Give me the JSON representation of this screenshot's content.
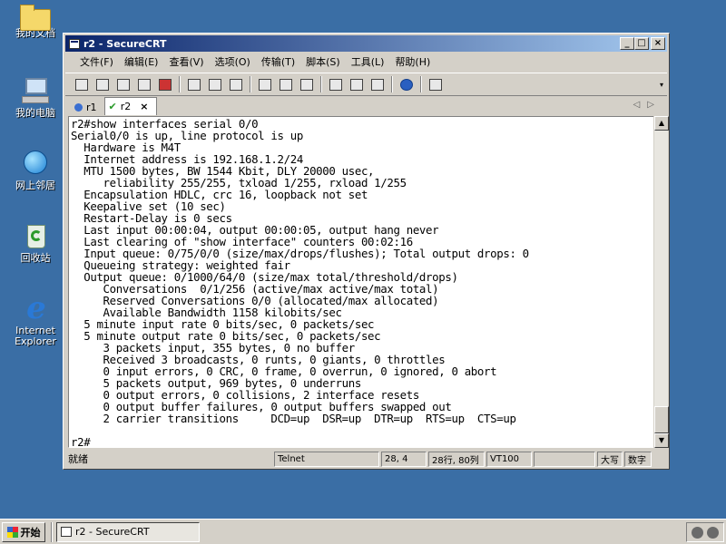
{
  "desktop": {
    "icons": [
      {
        "label": "我的文档",
        "icon": "folder-icon"
      },
      {
        "label": "我的电脑",
        "icon": "computer-icon"
      },
      {
        "label": "网上邻居",
        "icon": "network-icon"
      },
      {
        "label": "回收站",
        "icon": "recycle-bin-icon"
      },
      {
        "label": "Internet Explorer",
        "icon": "ie-icon"
      }
    ]
  },
  "window": {
    "title": "r2 - SecureCRT",
    "controls": {
      "minimize": "_",
      "maximize": "□",
      "close": "×"
    }
  },
  "menu": [
    "文件(F)",
    "编辑(E)",
    "查看(V)",
    "选项(O)",
    "传输(T)",
    "脚本(S)",
    "工具(L)",
    "帮助(H)"
  ],
  "tabs": [
    {
      "label": "r1",
      "active": false
    },
    {
      "label": "r2",
      "active": true,
      "close": "×"
    }
  ],
  "terminal": {
    "lines": [
      "r2#show interfaces serial 0/0",
      "Serial0/0 is up, line protocol is up",
      "  Hardware is M4T",
      "  Internet address is 192.168.1.2/24",
      "  MTU 1500 bytes, BW 1544 Kbit, DLY 20000 usec,",
      "     reliability 255/255, txload 1/255, rxload 1/255",
      "  Encapsulation HDLC, crc 16, loopback not set",
      "  Keepalive set (10 sec)",
      "  Restart-Delay is 0 secs",
      "  Last input 00:00:04, output 00:00:05, output hang never",
      "  Last clearing of \"show interface\" counters 00:02:16",
      "  Input queue: 0/75/0/0 (size/max/drops/flushes); Total output drops: 0",
      "  Queueing strategy: weighted fair",
      "  Output queue: 0/1000/64/0 (size/max total/threshold/drops)",
      "     Conversations  0/1/256 (active/max active/max total)",
      "     Reserved Conversations 0/0 (allocated/max allocated)",
      "     Available Bandwidth 1158 kilobits/sec",
      "  5 minute input rate 0 bits/sec, 0 packets/sec",
      "  5 minute output rate 0 bits/sec, 0 packets/sec",
      "     3 packets input, 355 bytes, 0 no buffer",
      "     Received 3 broadcasts, 0 runts, 0 giants, 0 throttles",
      "     0 input errors, 0 CRC, 0 frame, 0 overrun, 0 ignored, 0 abort",
      "     5 packets output, 969 bytes, 0 underruns",
      "     0 output errors, 0 collisions, 2 interface resets",
      "     0 output buffer failures, 0 output buffers swapped out",
      "     2 carrier transitions     DCD=up  DSR=up  DTR=up  RTS=up  CTS=up",
      "",
      "r2#"
    ]
  },
  "statusbar": {
    "ready": "就绪",
    "protocol": "Telnet",
    "cursor": "28,  4",
    "size": "28行, 80列",
    "emulation": "VT100",
    "caps": "大写",
    "num": "数字"
  },
  "taskbar": {
    "start": "开始",
    "task": "r2 - SecureCRT"
  }
}
